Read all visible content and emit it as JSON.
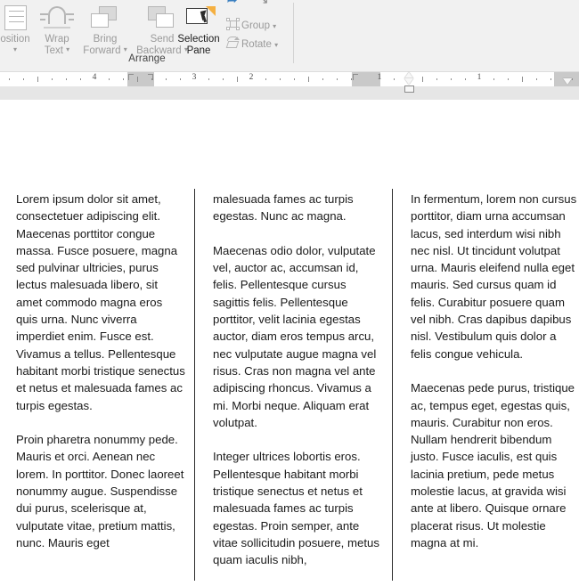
{
  "ribbon": {
    "group_label": "Arrange",
    "buttons": [
      {
        "id": "position",
        "label_line1": "osition",
        "label_line2": "",
        "icon": "position-icon",
        "has_caret": true,
        "enabled": false
      },
      {
        "id": "wrap-text",
        "label_line1": "Wrap",
        "label_line2": "Text",
        "icon": "wrap-text-icon",
        "has_caret": true,
        "enabled": false
      },
      {
        "id": "bring-forward",
        "label_line1": "Bring",
        "label_line2": "Forward",
        "icon": "bring-forward-icon",
        "has_caret": true,
        "enabled": false
      },
      {
        "id": "send-backward",
        "label_line1": "Send",
        "label_line2": "Backward",
        "icon": "send-backward-icon",
        "has_caret": true,
        "enabled": false
      },
      {
        "id": "selection-pane",
        "label_line1": "Selection",
        "label_line2": "Pane",
        "icon": "selection-pane-icon",
        "has_caret": false,
        "enabled": true
      }
    ],
    "small_buttons": [
      {
        "id": "group",
        "label": "Group",
        "icon": "group-icon",
        "caret": "▾",
        "enabled": false
      },
      {
        "id": "rotate",
        "label": "Rotate",
        "icon": "rotate-icon",
        "caret": "▾",
        "enabled": false
      }
    ],
    "caret_glyph": "▾"
  },
  "ruler": {
    "labels": [
      "4",
      "3",
      "2",
      "1",
      "1"
    ],
    "left_margin_mark": "left-margin-marker",
    "right_margin_mark": "right-margin-marker",
    "indent_markers": [
      "first-line-indent",
      "hanging-indent",
      "left-indent",
      "right-indent"
    ]
  },
  "document": {
    "columns": [
      {
        "id": "column-1",
        "paragraphs": [
          "Lorem ipsum dolor sit amet, consectetuer adipiscing elit. Maecenas porttitor congue massa. Fusce posuere, magna sed pulvinar ultricies, purus lectus malesuada libero, sit amet commodo magna eros quis urna. Nunc viverra imperdiet enim. Fusce est. Vivamus a tellus. Pellentesque habitant morbi tristique senectus et netus et malesuada fames ac turpis egestas.",
          "Proin pharetra nonummy pede. Mauris et orci. Aenean nec lorem. In porttitor. Donec laoreet nonummy augue. Suspendisse dui purus, scelerisque at, vulputate vitae, pretium mattis, nunc. Mauris eget"
        ]
      },
      {
        "id": "column-2",
        "paragraphs": [
          "malesuada fames ac turpis egestas. Nunc ac magna.",
          "Maecenas odio dolor, vulputate vel, auctor ac, accumsan id, felis. Pellentesque cursus sagittis felis. Pellentesque porttitor, velit lacinia egestas auctor, diam eros tempus arcu, nec vulputate augue magna vel risus. Cras non magna vel ante adipiscing rhoncus. Vivamus a mi. Morbi neque. Aliquam erat volutpat.",
          "Integer ultrices lobortis eros. Pellentesque habitant morbi tristique senectus et netus et malesuada fames ac turpis egestas. Proin semper, ante vitae sollicitudin posuere, metus quam iaculis nibh,"
        ]
      },
      {
        "id": "column-3",
        "paragraphs": [
          "In fermentum, lorem non cursus porttitor, diam urna accumsan lacus, sed interdum wisi nibh nec nisl. Ut tincidunt volutpat urna. Mauris eleifend nulla eget mauris. Sed cursus quam id felis. Curabitur posuere quam vel nibh. Cras dapibus dapibus nisl. Vestibulum quis dolor a felis congue vehicula.",
          "Maecenas pede purus, tristique ac, tempus eget, egestas quis, mauris. Curabitur non eros. Nullam hendrerit bibendum justo. Fusce iaculis, est quis lacinia pretium, pede metus molestie lacus, at gravida wisi ante at libero. Quisque ornare placerat risus. Ut molestie magna at mi."
        ]
      }
    ]
  },
  "colors": {
    "ribbon_bg": "#f1f1f1",
    "ruler_bg": "#e6e6e6",
    "ruler_margin": "#c9c9c9",
    "page_bg": "#ffffff",
    "text": "#1a1a1a",
    "disabled_text": "#9a9a9a",
    "accent_orange": "#f5b041",
    "accent_blue": "#3a7fc1"
  }
}
